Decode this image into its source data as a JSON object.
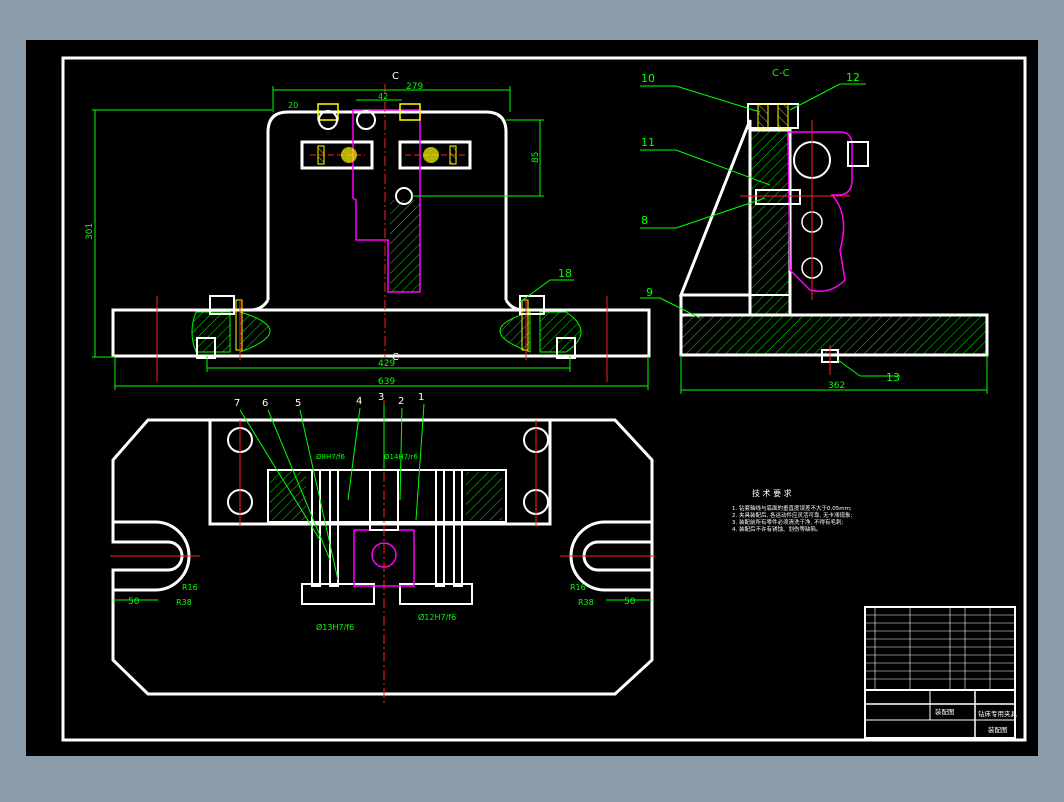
{
  "colors": {
    "outer_bg": "#8a9baa",
    "sheet": "#000000",
    "frame": "#ffffff",
    "dimension": "#00ff00",
    "hatch": "#00ff00",
    "centerline": "#ff2020",
    "part_highlight": "#ff00ff",
    "fastener": "#ffff00"
  },
  "section_labels": {
    "top": "C",
    "bottom": "C",
    "side_view": "C-C"
  },
  "dimensions": {
    "width_279": "279",
    "offset_42": "42",
    "small_20": "20",
    "height_301": "301",
    "height_85": "85",
    "base_429": "429",
    "overall_639": "639",
    "side_362": "362",
    "slot_50_left": "50",
    "slot_50_right": "50",
    "radius_r16_left": "R16",
    "radius_r38_left": "R38",
    "radius_r16_right": "R16",
    "radius_r38_right": "R38",
    "fit_top_left": "Ø8H7/f6",
    "fit_top_right": "Ø14H7/r6",
    "fit_bottom_left": "Ø13H7/f6",
    "fit_bottom_right": "Ø12H7/f6"
  },
  "callouts_side": [
    "10",
    "12",
    "11",
    "8",
    "9",
    "13"
  ],
  "callouts_front": [
    "18"
  ],
  "callouts_plan": [
    "7",
    "6",
    "5",
    "4",
    "3",
    "2",
    "1"
  ],
  "notes": {
    "title": "技 术 要 求",
    "lines": [
      "1. 钻套轴线与底面的垂直度误差不大于0.05mm;",
      "2. 夹具装配后, 各运动件应灵活可靠, 无卡滞现象;",
      "3. 装配前所有零件必须清洗干净, 不得有毛刺;",
      "4. 装配后不许有锈蚀、划伤等缺陷。"
    ]
  },
  "title_block": {
    "drawing_name": "钻床专用夹具",
    "drawing_no": "装配图",
    "school": "装配图"
  }
}
